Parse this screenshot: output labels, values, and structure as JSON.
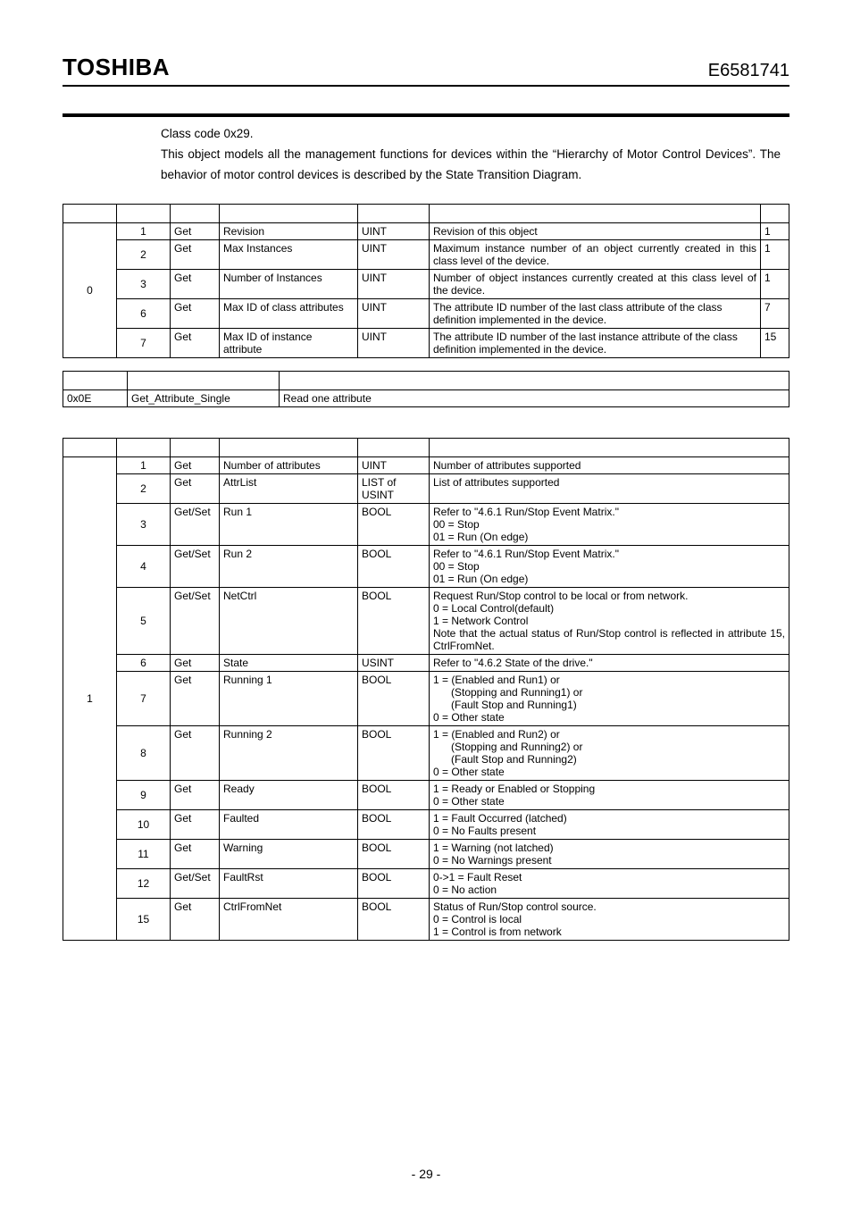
{
  "header": {
    "logo": "TOSHIBA",
    "doc_code": "E6581741"
  },
  "intro": {
    "line1": "Class code 0x29.",
    "line2": "This object models all the management functions for devices within the “Hierarchy of Motor Control Devices”. The behavior of motor control devices is described by the State Transition Diagram."
  },
  "class_attr": {
    "instance": "0",
    "rows": [
      {
        "id": "1",
        "access": "Get",
        "name": "Revision",
        "type": "UINT",
        "sem": "Revision of this object",
        "val": "1"
      },
      {
        "id": "2",
        "access": "Get",
        "name": "Max Instances",
        "type": "UINT",
        "sem": "Maximum instance number of an object currently created in this class level of the device.",
        "val": "1"
      },
      {
        "id": "3",
        "access": "Get",
        "name": "Number of Instances",
        "type": "UINT",
        "sem": "Number of object instances currently created at this class level of the device.",
        "val": "1"
      },
      {
        "id": "6",
        "access": "Get",
        "name": "Max ID of class attributes",
        "type": "UINT",
        "sem": "The attribute ID number of the last class attribute of the class definition implemented in the device.",
        "val": "7"
      },
      {
        "id": "7",
        "access": "Get",
        "name": "Max ID of instance attribute",
        "type": "UINT",
        "sem": "The attribute ID number of the last instance attribute of the class definition implemented in the device.",
        "val": "15"
      }
    ]
  },
  "services": {
    "code": "0x0E",
    "name": "Get_Attribute_Single",
    "desc": "Read one attribute"
  },
  "inst_attr": {
    "instance": "1",
    "rows": [
      {
        "id": "1",
        "access": "Get",
        "name": "Number of attributes",
        "type": "UINT",
        "sem": "Number of attributes supported"
      },
      {
        "id": "2",
        "access": "Get",
        "name": "AttrList",
        "type": "LIST of USINT",
        "sem": "List of attributes supported"
      },
      {
        "id": "3",
        "access": "Get/Set",
        "name": "Run 1",
        "type": "BOOL",
        "sem": "Refer to \"4.6.1 Run/Stop Event Matrix.\"\n00 = Stop\n01 = Run (On edge)"
      },
      {
        "id": "4",
        "access": "Get/Set",
        "name": "Run 2",
        "type": "BOOL",
        "sem": "Refer to \"4.6.1 Run/Stop Event Matrix.\"\n00 = Stop\n01 = Run (On edge)"
      },
      {
        "id": "5",
        "access": "Get/Set",
        "name": "NetCtrl",
        "type": "BOOL",
        "sem": "Request Run/Stop control to be local or from network.\n0 = Local Control(default)\n1 = Network Control\nNote that the actual status of Run/Stop control is reflected in attribute 15, CtrlFromNet."
      },
      {
        "id": "6",
        "access": "Get",
        "name": "State",
        "type": "USINT",
        "sem": "Refer to \"4.6.2 State of the drive.\""
      },
      {
        "id": "7",
        "access": "Get",
        "name": "Running 1",
        "type": "BOOL",
        "sem": "1 = (Enabled and Run1) or\n      (Stopping and Running1) or\n      (Fault Stop and Running1)\n0 = Other state"
      },
      {
        "id": "8",
        "access": "Get",
        "name": "Running 2",
        "type": "BOOL",
        "sem": "1 = (Enabled and Run2) or\n      (Stopping and Running2) or\n      (Fault Stop and Running2)\n0 = Other state"
      },
      {
        "id": "9",
        "access": "Get",
        "name": "Ready",
        "type": "BOOL",
        "sem": "1 = Ready or Enabled or Stopping\n0 = Other state"
      },
      {
        "id": "10",
        "access": "Get",
        "name": "Faulted",
        "type": "BOOL",
        "sem": "1 = Fault Occurred (latched)\n0 = No Faults present"
      },
      {
        "id": "11",
        "access": "Get",
        "name": "Warning",
        "type": "BOOL",
        "sem": "1 = Warning (not latched)\n0 = No Warnings present"
      },
      {
        "id": "12",
        "access": "Get/Set",
        "name": "FaultRst",
        "type": "BOOL",
        "sem": "0->1 = Fault Reset\n0 = No action"
      },
      {
        "id": "15",
        "access": "Get",
        "name": "CtrlFromNet",
        "type": "BOOL",
        "sem": "Status of Run/Stop control source.\n0 = Control is local\n1 = Control is from network"
      }
    ]
  },
  "page_number": "- 29 -"
}
